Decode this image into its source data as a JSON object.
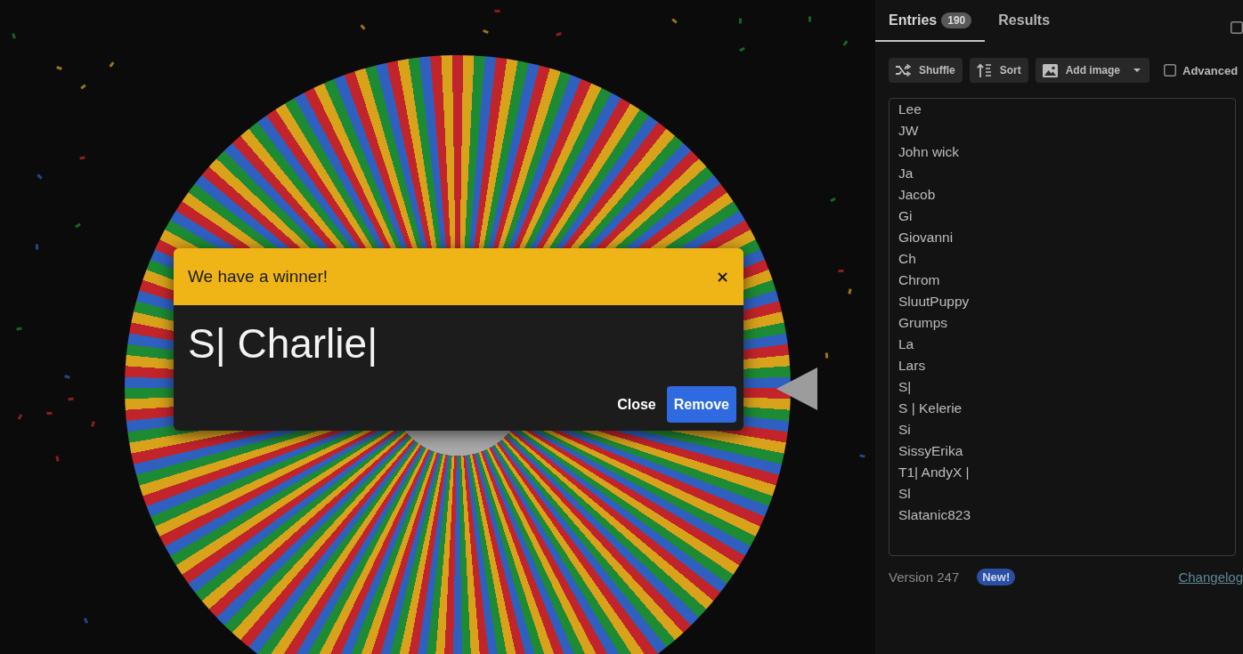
{
  "dialog": {
    "title": "We have a winner!",
    "winner": "S| Charlie|",
    "buttons": [
      {
        "label": "Close",
        "kind": "plain"
      },
      {
        "label": "Remove",
        "kind": "primary"
      }
    ]
  },
  "tabs": [
    {
      "label": "Entries",
      "badge": "190",
      "selected": true
    },
    {
      "label": "Results",
      "selected": false
    }
  ],
  "tab_bar_checkbox": {
    "checked": false
  },
  "toolbar": {
    "buttons": [
      {
        "label": "Shuffle",
        "kind": "shuffle",
        "dropdown": false
      },
      {
        "label": "Sort",
        "kind": "sort",
        "dropdown": false
      },
      {
        "label": "Add image",
        "kind": "image",
        "dropdown": true
      }
    ],
    "checkbox": {
      "label": "Advanced",
      "checked": false
    }
  },
  "entries": [
    "Lee",
    "JW",
    "John wick",
    "Ja",
    "Jacob",
    "Gi",
    "Giovanni",
    "Ch",
    "Chrom",
    "SluutPuppy",
    "Grumps",
    "La",
    "Lars",
    "S|",
    "S | Kelerie",
    "Si",
    "SissyErika",
    "T1| AndyX |",
    "Sl",
    "Slatanic823"
  ],
  "footer": {
    "version": "Version 247",
    "badge": "New!",
    "link": "Changelog"
  }
}
